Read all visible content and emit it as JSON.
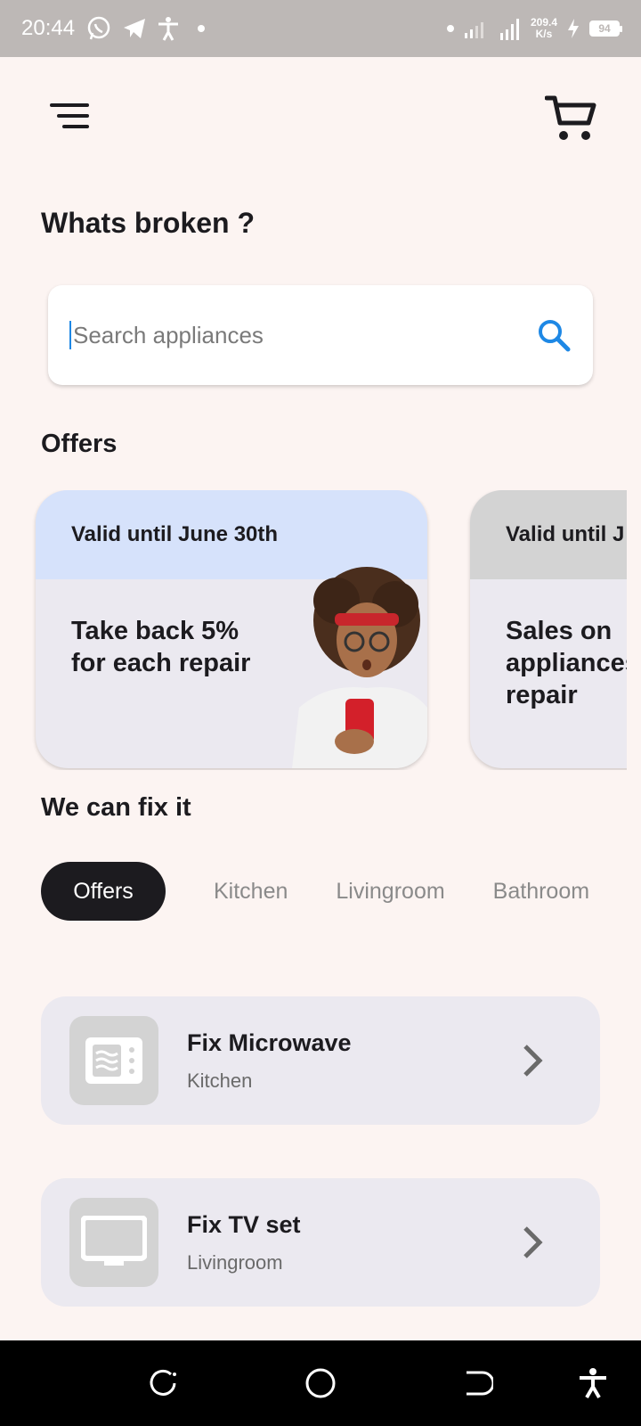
{
  "status_bar": {
    "time": "20:44",
    "speed_value": "209.4",
    "speed_unit": "K/s",
    "battery": "94"
  },
  "header": {
    "menu_icon": "menu-icon",
    "cart_icon": "shopping-cart-icon"
  },
  "page": {
    "title": "Whats broken ?"
  },
  "search": {
    "placeholder": "Search appliances",
    "value": ""
  },
  "offers": {
    "section_title": "Offers",
    "cards": [
      {
        "valid": "Valid until June 30th",
        "text": "Take back 5% for each repair",
        "header_color": "#d6e2fb"
      },
      {
        "valid": "Valid until J",
        "text": "Sales on appliances repair",
        "header_color": "#d3d3d3"
      }
    ]
  },
  "fix": {
    "section_title": "We can fix it",
    "chips": [
      "Offers",
      "Kitchen",
      "Livingroom",
      "Bathroom"
    ],
    "active_chip": "Offers"
  },
  "services": [
    {
      "title": "Fix Microwave",
      "category": "Kitchen",
      "icon": "microwave-icon"
    },
    {
      "title": "Fix TV set",
      "category": "Livingroom",
      "icon": "tv-icon"
    }
  ],
  "colors": {
    "background": "#fcf4f2",
    "accent": "#1e88e5",
    "dark": "#1c1b1f"
  }
}
